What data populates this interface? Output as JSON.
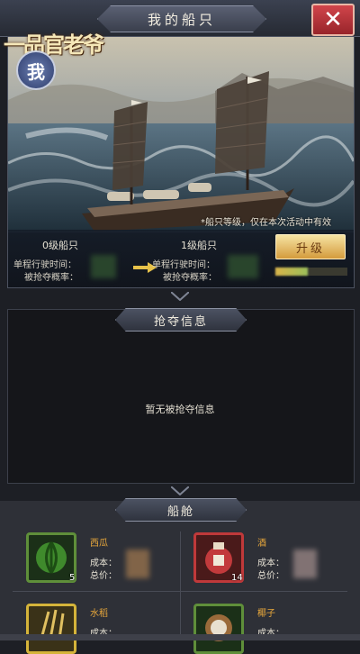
{
  "header": {
    "title": "我的船只",
    "close_label": "✕"
  },
  "logo": {
    "text": "一品官老爷",
    "seal": "我"
  },
  "ship": {
    "note": "*船只等级，仅在本次活动中有效"
  },
  "upgrade": {
    "current_level": "0级船只",
    "next_level": "1级船只",
    "time_label_left": "单程行驶时间：",
    "rate_label_left": "被抢夺概率：",
    "time_label_right": "单程行驶时间：",
    "rate_label_right": "被抢夺概率：",
    "button_label": "升级",
    "progress": 0.45
  },
  "plunder": {
    "title": "抢夺信息",
    "empty_message": "暂无被抢夺信息"
  },
  "cabin": {
    "title": "船舱",
    "items": [
      {
        "name": "西瓜",
        "cost_label": "成本：",
        "total_label": "总价：",
        "count": "5",
        "frame_color": "#5f8f3a",
        "icon": "watermelon-icon"
      },
      {
        "name": "酒",
        "cost_label": "成本：",
        "total_label": "总价：",
        "count": "14",
        "frame_color": "#c0393a",
        "icon": "wine-jar-icon"
      },
      {
        "name": "水稻",
        "cost_label": "成本：",
        "count": "",
        "frame_color": "#d5b43a",
        "icon": "rice-icon"
      },
      {
        "name": "椰子",
        "cost_label": "成本：",
        "count": "",
        "frame_color": "#5f8f3a",
        "icon": "coconut-icon"
      }
    ]
  }
}
